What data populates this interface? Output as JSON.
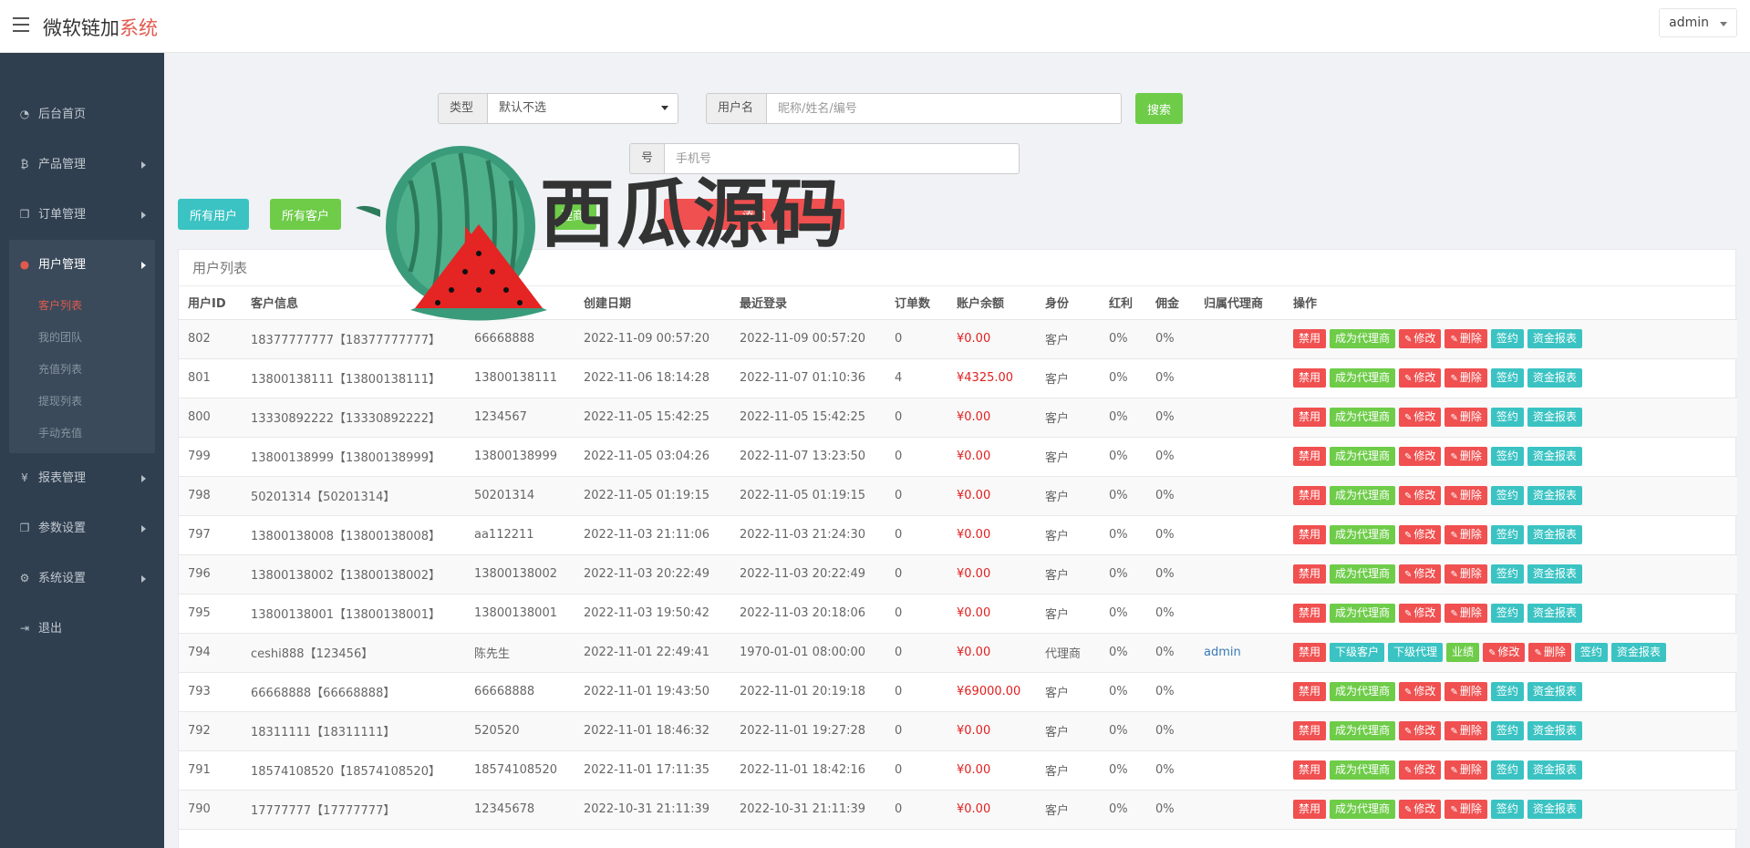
{
  "header": {
    "brand_main": "微软链加",
    "brand_accent": "系统",
    "user": "admin"
  },
  "sidebar": {
    "items": [
      {
        "icon": "dashboard-icon",
        "label": "后台首页"
      },
      {
        "icon": "bitcoin-icon",
        "label": "产品管理"
      },
      {
        "icon": "copy-icon",
        "label": "订单管理"
      },
      {
        "icon": "user-icon",
        "label": "用户管理"
      },
      {
        "icon": "yen-icon",
        "label": "报表管理"
      },
      {
        "icon": "copy-icon",
        "label": "参数设置"
      },
      {
        "icon": "gears-icon",
        "label": "系统设置"
      },
      {
        "icon": "sign-out-icon",
        "label": "退出"
      }
    ],
    "sub_items": [
      "客户列表",
      "我的团队",
      "充值列表",
      "提现列表",
      "手动充值"
    ]
  },
  "search": {
    "type_label": "类型",
    "type_value": "默认不选",
    "username_label": "用户名",
    "username_placeholder": "昵称/姓名/编号",
    "phone_label": "号",
    "phone_placeholder": "手机号",
    "search_button": "搜索"
  },
  "filters": {
    "all_users": "所有用户",
    "all_customers": "所有客户",
    "agents_partial": "理商",
    "add_partial": "添加"
  },
  "panel": {
    "title": "用户列表"
  },
  "table": {
    "headers": [
      "用户ID",
      "客户信息",
      "客户名称",
      "创建日期",
      "最近登录",
      "订单数",
      "账户余额",
      "身份",
      "红利",
      "佣金",
      "归属代理商",
      "操作"
    ],
    "customer_actions": [
      "禁用",
      "成为代理商",
      "修改",
      "删除",
      "签约",
      "资金报表"
    ],
    "agent_actions": [
      "禁用",
      "下级客户",
      "下级代理",
      "业绩",
      "修改",
      "删除",
      "签约",
      "资金报表"
    ],
    "rows": [
      {
        "id": "802",
        "info": "18377777777【18377777777】",
        "name": "66668888",
        "created": "2022-11-09 00:57:20",
        "login": "2022-11-09 00:57:20",
        "orders": "0",
        "balance": "¥0.00",
        "role": "客户",
        "bonus": "0%",
        "commission": "0%",
        "agent": "",
        "type": "customer"
      },
      {
        "id": "801",
        "info": "13800138111【13800138111】",
        "name": "13800138111",
        "created": "2022-11-06 18:14:28",
        "login": "2022-11-07 01:10:36",
        "orders": "4",
        "balance": "¥4325.00",
        "role": "客户",
        "bonus": "0%",
        "commission": "0%",
        "agent": "",
        "type": "customer"
      },
      {
        "id": "800",
        "info": "13330892222【13330892222】",
        "name": "1234567",
        "created": "2022-11-05 15:42:25",
        "login": "2022-11-05 15:42:25",
        "orders": "0",
        "balance": "¥0.00",
        "role": "客户",
        "bonus": "0%",
        "commission": "0%",
        "agent": "",
        "type": "customer"
      },
      {
        "id": "799",
        "info": "13800138999【13800138999】",
        "name": "13800138999",
        "created": "2022-11-05 03:04:26",
        "login": "2022-11-07 13:23:50",
        "orders": "0",
        "balance": "¥0.00",
        "role": "客户",
        "bonus": "0%",
        "commission": "0%",
        "agent": "",
        "type": "customer"
      },
      {
        "id": "798",
        "info": "50201314【50201314】",
        "name": "50201314",
        "created": "2022-11-05 01:19:15",
        "login": "2022-11-05 01:19:15",
        "orders": "0",
        "balance": "¥0.00",
        "role": "客户",
        "bonus": "0%",
        "commission": "0%",
        "agent": "",
        "type": "customer"
      },
      {
        "id": "797",
        "info": "13800138008【13800138008】",
        "name": "aa112211",
        "created": "2022-11-03 21:11:06",
        "login": "2022-11-03 21:24:30",
        "orders": "0",
        "balance": "¥0.00",
        "role": "客户",
        "bonus": "0%",
        "commission": "0%",
        "agent": "",
        "type": "customer"
      },
      {
        "id": "796",
        "info": "13800138002【13800138002】",
        "name": "13800138002",
        "created": "2022-11-03 20:22:49",
        "login": "2022-11-03 20:22:49",
        "orders": "0",
        "balance": "¥0.00",
        "role": "客户",
        "bonus": "0%",
        "commission": "0%",
        "agent": "",
        "type": "customer"
      },
      {
        "id": "795",
        "info": "13800138001【13800138001】",
        "name": "13800138001",
        "created": "2022-11-03 19:50:42",
        "login": "2022-11-03 20:18:06",
        "orders": "0",
        "balance": "¥0.00",
        "role": "客户",
        "bonus": "0%",
        "commission": "0%",
        "agent": "",
        "type": "customer"
      },
      {
        "id": "794",
        "info": "ceshi888【123456】",
        "name": "陈先生",
        "created": "2022-11-01 22:49:41",
        "login": "1970-01-01 08:00:00",
        "orders": "0",
        "balance": "¥0.00",
        "role": "代理商",
        "bonus": "0%",
        "commission": "0%",
        "agent": "admin",
        "type": "agent"
      },
      {
        "id": "793",
        "info": "66668888【66668888】",
        "name": "66668888",
        "created": "2022-11-01 19:43:50",
        "login": "2022-11-01 20:19:18",
        "orders": "0",
        "balance": "¥69000.00",
        "role": "客户",
        "bonus": "0%",
        "commission": "0%",
        "agent": "",
        "type": "customer"
      },
      {
        "id": "792",
        "info": "18311111【18311111】",
        "name": "520520",
        "created": "2022-11-01 18:46:32",
        "login": "2022-11-01 19:27:28",
        "orders": "0",
        "balance": "¥0.00",
        "role": "客户",
        "bonus": "0%",
        "commission": "0%",
        "agent": "",
        "type": "customer"
      },
      {
        "id": "791",
        "info": "18574108520【18574108520】",
        "name": "18574108520",
        "created": "2022-11-01 17:11:35",
        "login": "2022-11-01 18:42:16",
        "orders": "0",
        "balance": "¥0.00",
        "role": "客户",
        "bonus": "0%",
        "commission": "0%",
        "agent": "",
        "type": "customer"
      },
      {
        "id": "790",
        "info": "17777777【17777777】",
        "name": "12345678",
        "created": "2022-10-31 21:11:39",
        "login": "2022-10-31 21:11:39",
        "orders": "0",
        "balance": "¥0.00",
        "role": "客户",
        "bonus": "0%",
        "commission": "0%",
        "agent": "",
        "type": "customer"
      }
    ]
  },
  "watermark": {
    "text": "西瓜源码"
  },
  "colors": {
    "red": "#f05050",
    "green": "#6ecc49",
    "teal": "#3bc3c3",
    "sidebar": "#2f3f4f",
    "accent": "#e05a4e"
  }
}
